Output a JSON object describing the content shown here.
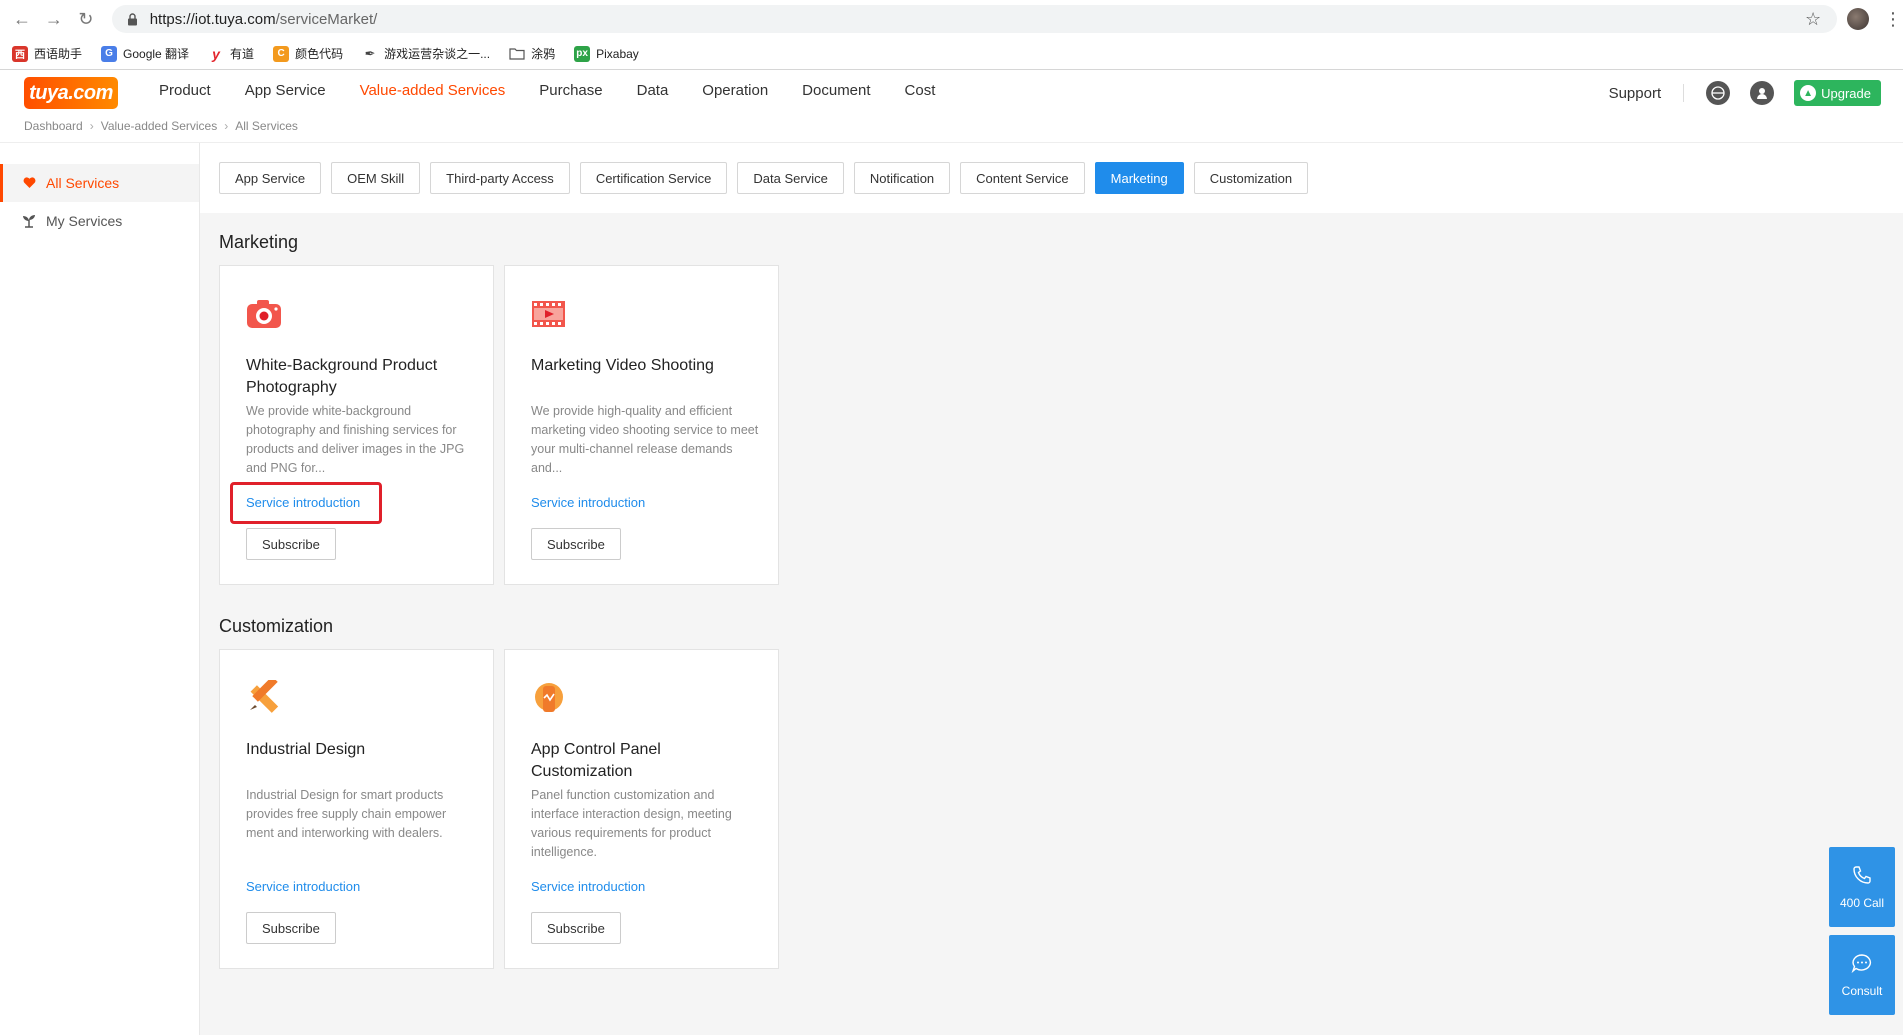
{
  "browser": {
    "url_host": "https://iot.tuya.com",
    "url_path": "/serviceMarket/",
    "bookmarks": [
      {
        "label": "西语助手",
        "icon": "xiyu-icon",
        "color": "#d9362b"
      },
      {
        "label": "Google 翻译",
        "icon": "google-translate-icon",
        "color": "#4a7ee8"
      },
      {
        "label": "有道",
        "icon": "youdao-icon",
        "color": "#e3262d"
      },
      {
        "label": "颜色代码",
        "icon": "color-code-icon",
        "color": "#f39a1e"
      },
      {
        "label": "游戏运营杂谈之一...",
        "icon": "feather-icon",
        "color": "#444444"
      },
      {
        "label": "涂鸦",
        "icon": "folder-icon",
        "color": "#666666"
      },
      {
        "label": "Pixabay",
        "icon": "pixabay-icon",
        "color": "#2ea348"
      }
    ]
  },
  "header": {
    "logo": "tuya.com",
    "nav": [
      "Product",
      "App Service",
      "Value-added Services",
      "Purchase",
      "Data",
      "Operation",
      "Document",
      "Cost"
    ],
    "active_nav": "Value-added Services",
    "support": "Support",
    "upgrade": "Upgrade"
  },
  "breadcrumb": [
    "Dashboard",
    "Value-added Services",
    "All Services"
  ],
  "sidebar": {
    "items": [
      {
        "label": "All Services",
        "icon": "heart-icon",
        "active": true
      },
      {
        "label": "My Services",
        "icon": "plant-icon",
        "active": false
      }
    ]
  },
  "tabs": [
    "App Service",
    "OEM Skill",
    "Third-party Access",
    "Certification Service",
    "Data Service",
    "Notification",
    "Content Service",
    "Marketing",
    "Customization"
  ],
  "active_tab": "Marketing",
  "sections": [
    {
      "title": "Marketing",
      "cards": [
        {
          "icon": "camera-icon",
          "title": "White-Background Product Photography",
          "desc": "We provide white-background photography and finishing services for products and deliver images in the JPG and PNG for...",
          "link": "Service introduction",
          "button": "Subscribe",
          "highlighted": true
        },
        {
          "icon": "film-icon",
          "title": "Marketing Video Shooting",
          "desc": "We provide high-quality and efficient marketing video shooting service to meet your multi-channel release demands and...",
          "link": "Service introduction",
          "button": "Subscribe",
          "highlighted": false
        }
      ]
    },
    {
      "title": "Customization",
      "cards": [
        {
          "icon": "pencil-ruler-icon",
          "title": "Industrial Design",
          "desc": "Industrial Design for smart products provides free supply chain empower ment and interworking with dealers.",
          "link": "Service introduction",
          "button": "Subscribe",
          "highlighted": false
        },
        {
          "icon": "phone-panel-icon",
          "title": "App Control Panel Customization",
          "desc": "Panel function customization and interface interaction design, meeting various requirements for product intelligence.",
          "link": "Service introduction",
          "button": "Subscribe",
          "highlighted": false
        }
      ]
    }
  ],
  "float": {
    "call": "400 Call",
    "consult": "Consult"
  },
  "colors": {
    "accent": "#ff4800",
    "primary_blue": "#1f8ceb",
    "upgrade_green": "#2db55d",
    "highlight_red": "#e0202a"
  }
}
